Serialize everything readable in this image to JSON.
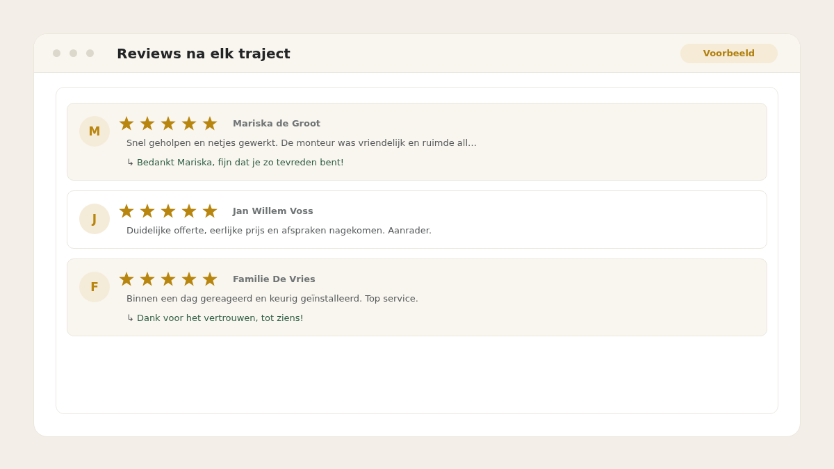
{
  "window": {
    "title": "Reviews na elk traject",
    "badge": "Voorbeeld"
  },
  "reviews": [
    {
      "initial": "M",
      "stars": 5,
      "name": "Mariska de Groot",
      "text": "Snel geholpen en netjes gewerkt. De monteur was vriendelijk en ruimde all…",
      "highlighted": true,
      "reply_marker": "↳",
      "reply": "Bedankt Mariska, fijn dat je zo tevreden bent!"
    },
    {
      "initial": "J",
      "stars": 5,
      "name": "Jan Willem Voss",
      "text": "Duidelijke offerte, eerlijke prijs en afspraken nagekomen. Aanrader.",
      "highlighted": false
    },
    {
      "initial": "F",
      "stars": 5,
      "name": "Familie De Vries",
      "text": "Binnen een dag gereageerd en keurig geïnstalleerd. Top service.",
      "highlighted": true,
      "reply_marker": "↳",
      "reply": "Dank voor het vertrouwen, tot ziens!"
    }
  ]
}
